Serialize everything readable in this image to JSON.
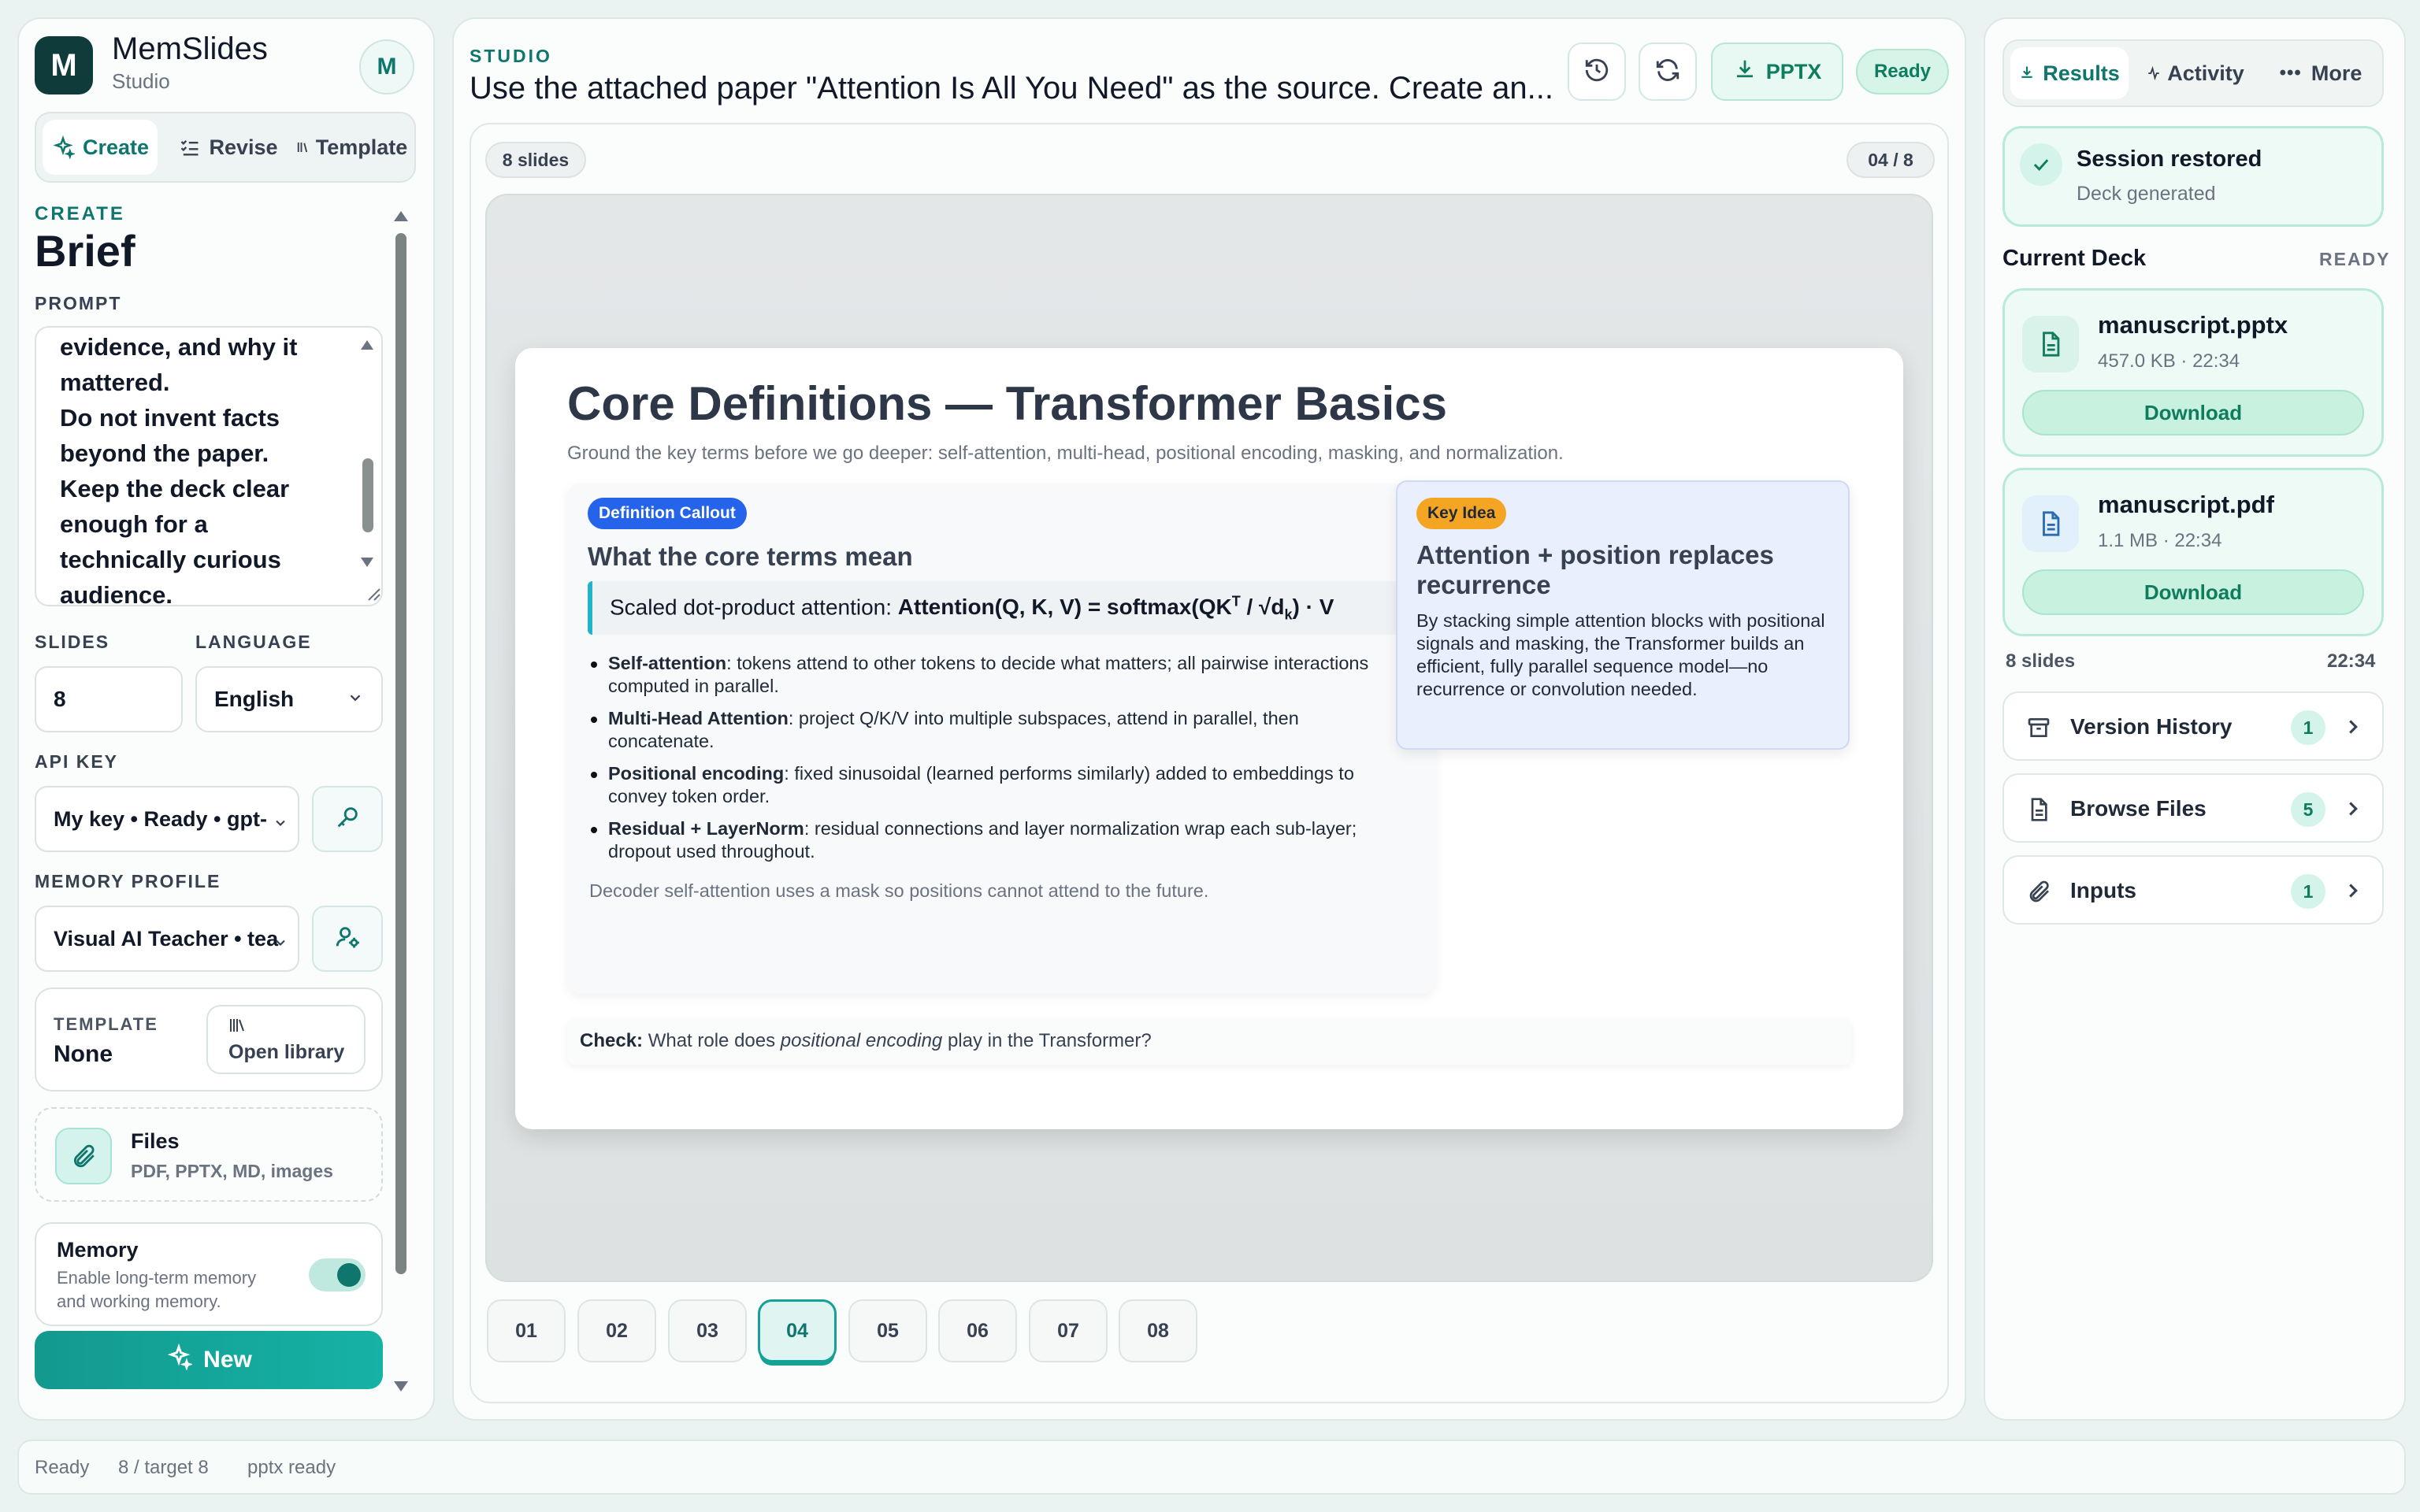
{
  "app": {
    "name": "MemSlides",
    "subtitle": "Studio",
    "logo_letter": "M",
    "avatar_letter": "M"
  },
  "left": {
    "tabs": [
      {
        "label": "Create",
        "active": true
      },
      {
        "label": "Revise"
      },
      {
        "label": "Template"
      }
    ],
    "section_kicker": "CREATE",
    "section_title": "Brief",
    "prompt_label": "PROMPT",
    "prompt_lines": [
      "evidence, and why it",
      "mattered.",
      "Do not invent facts",
      "beyond the paper.",
      "Keep the deck clear",
      "enough for a",
      "technically curious",
      "audience."
    ],
    "slides_label": "SLIDES",
    "slides_value": "8",
    "language_label": "LANGUAGE",
    "language_value": "English",
    "api_label": "API KEY",
    "api_value": "My key • Ready • gpt-",
    "memory_profile_label": "MEMORY PROFILE",
    "memory_profile_value": "Visual AI Teacher • tea",
    "template_label": "TEMPLATE",
    "template_value": "None",
    "open_library": "Open library",
    "files_title": "Files",
    "files_sub": "PDF, PPTX, MD, images",
    "memory_title": "Memory",
    "memory_sub1": "Enable long-term memory",
    "memory_sub2": "and working memory.",
    "memory_enabled": true,
    "new_button": "New"
  },
  "center": {
    "kicker": "STUDIO",
    "title": "Use the attached paper \"Attention Is All You Need\" as the source. Create an...",
    "pptx_label": "PPTX",
    "status": "Ready",
    "slide_count_badge": "8 slides",
    "page_indicator": "04 / 8",
    "thumbnails": [
      "01",
      "02",
      "03",
      "04",
      "05",
      "06",
      "07",
      "08"
    ],
    "active_thumb": "04"
  },
  "slide": {
    "title": "Core Definitions — Transformer Basics",
    "subtitle": "Ground the key terms before we go deeper: self-attention, multi-head, positional encoding, masking, and normalization.",
    "callout_badge": "Definition Callout",
    "callout_heading": "What the core terms mean",
    "formula_prefix": "Scaled dot-product attention: ",
    "formula_a": "Attention(Q, K, V) = softmax(QK",
    "formula_sup": "T",
    "formula_b": " / √d",
    "formula_sub": "k",
    "formula_c": ") · V",
    "bullets": [
      {
        "term": "Self-attention",
        "text": ": tokens attend to other tokens to decide what matters; all pairwise interactions computed in parallel."
      },
      {
        "term": "Multi-Head Attention",
        "text": ": project Q/K/V into multiple subspaces, attend in parallel, then concatenate."
      },
      {
        "term": "Positional encoding",
        "text": ": fixed sinusoidal (learned performs similarly) added to embeddings to convey token order."
      },
      {
        "term": "Residual + LayerNorm",
        "text": ": residual connections and layer normalization wrap each sub-layer; dropout used throughout."
      }
    ],
    "note": "Decoder self-attention uses a mask so positions cannot attend to the future.",
    "key_badge": "Key Idea",
    "key_heading": "Attention + position replaces recurrence",
    "key_body": "By stacking simple attention blocks with positional signals and masking, the Transformer builds an efficient, fully parallel sequence model—no recurrence or convolution needed.",
    "check_label": "Check:",
    "check_pre": " What role does ",
    "check_em": "positional encoding",
    "check_post": " play in the Transformer?"
  },
  "right": {
    "tabs": [
      {
        "label": "Results",
        "active": true
      },
      {
        "label": "Activity"
      },
      {
        "label": "More"
      }
    ],
    "session_title": "Session restored",
    "session_sub": "Deck generated",
    "deck_title": "Current Deck",
    "deck_status": "READY",
    "files": [
      {
        "name": "manuscript.pptx",
        "meta": "457.0 KB · 22:34",
        "action": "Download"
      },
      {
        "name": "manuscript.pdf",
        "meta": "1.1 MB · 22:34",
        "action": "Download"
      }
    ],
    "summary_left": "8 slides",
    "summary_right": "22:34",
    "rows": [
      {
        "label": "Version History",
        "count": "1"
      },
      {
        "label": "Browse Files",
        "count": "5"
      },
      {
        "label": "Inputs",
        "count": "1"
      }
    ]
  },
  "statusbar": {
    "items": [
      "Ready",
      "8 / target 8",
      "pptx ready"
    ]
  },
  "colors": {
    "accent": "#14a196",
    "accent_dark": "#0f766e",
    "logo_bg": "#0f3b3a",
    "callout_blue": "#2563eb",
    "key_orange": "#f5a524",
    "success": "#0f7c5e"
  }
}
